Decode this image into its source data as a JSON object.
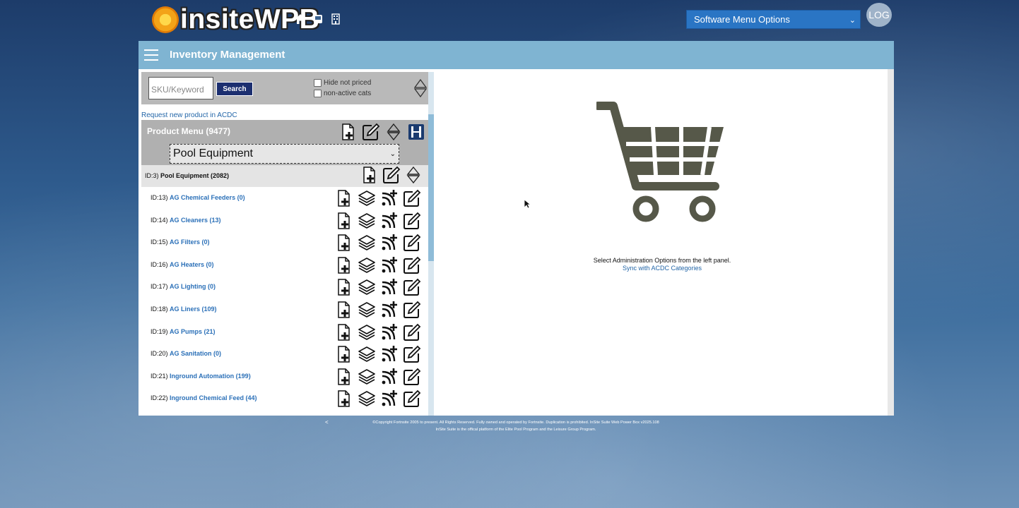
{
  "header": {
    "logo_text": "insiteWPB",
    "menu_select_value": "Software Menu Options",
    "log_button": "LOG"
  },
  "titlebar": {
    "title": "Inventory Management"
  },
  "search": {
    "placeholder": "SKU/Keyword",
    "button": "Search",
    "hide_not_priced": "Hide not priced",
    "non_active_cats": "non-active cats"
  },
  "request_link": "Request new product in ACDC",
  "product_menu": {
    "label": "Product Menu (9477)",
    "selected": "Pool Equipment"
  },
  "category_header": {
    "id": "ID:3)",
    "name": "Pool Equipment (2082)"
  },
  "rows": [
    {
      "id": "ID:13)",
      "name": "AG Chemical Feeders (0)"
    },
    {
      "id": "ID:14)",
      "name": "AG Cleaners (13)"
    },
    {
      "id": "ID:15)",
      "name": "AG Filters (0)"
    },
    {
      "id": "ID:16)",
      "name": "AG Heaters (0)"
    },
    {
      "id": "ID:17)",
      "name": "AG Lighting (0)"
    },
    {
      "id": "ID:18)",
      "name": "AG Liners (109)"
    },
    {
      "id": "ID:19)",
      "name": "AG Pumps (21)"
    },
    {
      "id": "ID:20)",
      "name": "AG Sanitation (0)"
    },
    {
      "id": "ID:21)",
      "name": "Inground Automation (199)"
    },
    {
      "id": "ID:22)",
      "name": "Inground Chemical Feed (44)"
    }
  ],
  "right_panel": {
    "message": "Select Administration Options from the left panel.",
    "sync_link": "Sync with ACDC Categories"
  },
  "footer": {
    "line1": "©Copyright Fortnsite 2005 to present. All Rights Reserved. Fully owned and operated by Fortnsite. Duplication is prohibited. InSite Suite Web Power Box v2025.108",
    "line2": "InSite Suite is the offical platform of the Elite Pool Program and the Leisure Group Program."
  },
  "colors": {
    "titlebar": "#7fb4d2",
    "link": "#2b70b8",
    "menu_select": "#2a75c4",
    "search_button": "#1c2f70"
  }
}
